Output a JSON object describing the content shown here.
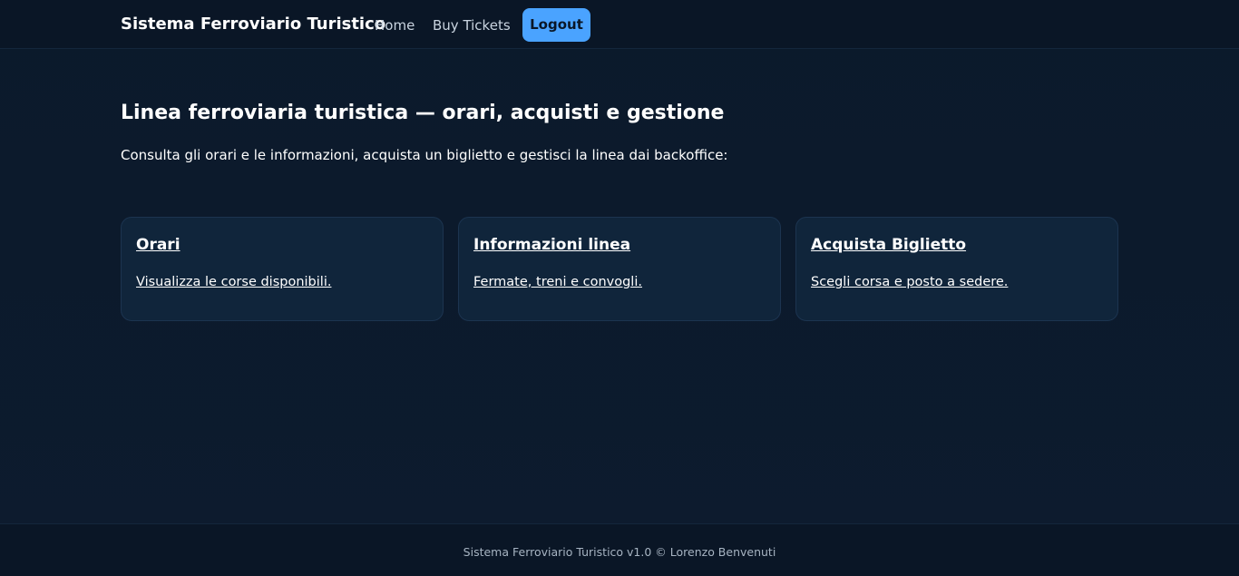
{
  "colors": {
    "background": "#0b1a2b",
    "navbar": "#0a1626",
    "card": "#10253b",
    "accent": "#4aa3ff",
    "text": "#ffffff",
    "muted": "#a7b4c2"
  },
  "navbar": {
    "brand": "Sistema Ferroviario Turistico",
    "links": [
      {
        "label": "Home"
      },
      {
        "label": "Buy Tickets"
      }
    ],
    "logout_label": "Logout"
  },
  "main": {
    "title": "Linea ferroviaria turistica — orari, acquisti e gestione",
    "lead": "Consulta gli orari e le informazioni, acquista un biglietto e gestisci la linea dai backoffice:",
    "cards": [
      {
        "title": "Orari",
        "description": "Visualizza le corse disponibili."
      },
      {
        "title": "Informazioni linea",
        "description": "Fermate, treni e convogli."
      },
      {
        "title": "Acquista Biglietto",
        "description": "Scegli corsa e posto a sedere."
      }
    ]
  },
  "footer": {
    "text": "Sistema Ferroviario Turistico v1.0 © Lorenzo Benvenuti"
  }
}
